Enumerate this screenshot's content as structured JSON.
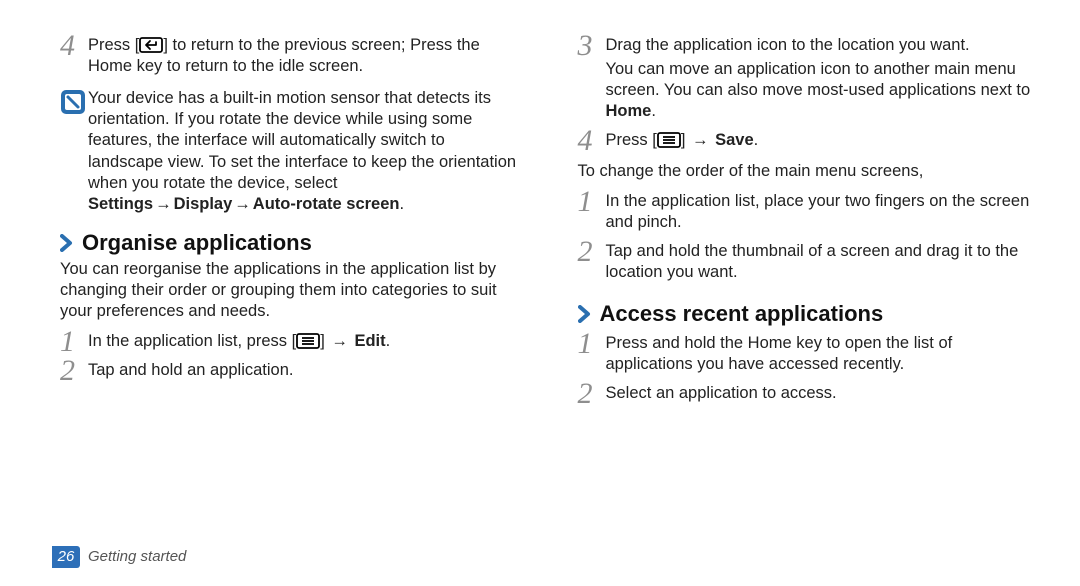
{
  "left": {
    "step4": {
      "num": "4",
      "line1_a": "Press [",
      "line1_b": "] to return to the previous screen; Press the Home key to return to the idle screen."
    },
    "note": {
      "text_a": "Your device has a built-in motion sensor that detects its orientation. If you rotate the device while using some features, the interface will automatically switch to landscape view. To set the interface to keep the orientation when you rotate the device, select ",
      "bold1": "Settings",
      "bold2": "Display",
      "bold3": "Auto-rotate screen",
      "period": "."
    },
    "head1": "Organise applications",
    "intro1": "You can reorganise the applications in the application list by changing their order or grouping them into categories to suit your preferences and needs.",
    "s1": {
      "num": "1",
      "text_a": "In the application list, press [",
      "text_b": "] ",
      "bold": "Edit",
      "period": "."
    },
    "s2": {
      "num": "2",
      "text": "Tap and hold an application."
    }
  },
  "right": {
    "s3": {
      "num": "3",
      "line1": "Drag the application icon to the location you want.",
      "line2_a": "You can move an application icon to another main menu screen. You can also move most-used applications next to ",
      "bold": "Home",
      "period": "."
    },
    "s4": {
      "num": "4",
      "text_a": "Press [",
      "text_b": "] ",
      "bold": "Save",
      "period": "."
    },
    "intro2": "To change the order of the main menu screens,",
    "o1": {
      "num": "1",
      "text": "In the application list, place your two fingers on the screen and pinch."
    },
    "o2": {
      "num": "2",
      "text": "Tap and hold the thumbnail of a screen and drag it to the location you want."
    },
    "head2": "Access recent applications",
    "a1": {
      "num": "1",
      "text": "Press and hold the Home key to open the list of applications you have accessed recently."
    },
    "a2": {
      "num": "2",
      "text": "Select an application to access."
    }
  },
  "footer": {
    "page": "26",
    "section": "Getting started"
  },
  "arrow": "→"
}
